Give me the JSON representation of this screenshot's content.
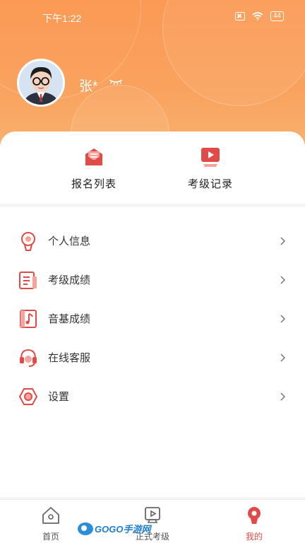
{
  "status_bar": {
    "time": "下午1:22",
    "battery": "44"
  },
  "profile": {
    "name": "张*"
  },
  "quick_actions": [
    {
      "label": "报名列表",
      "icon": "envelope-list-icon"
    },
    {
      "label": "考级记录",
      "icon": "play-record-icon"
    }
  ],
  "menu": [
    {
      "label": "个人信息",
      "icon": "person-badge-icon"
    },
    {
      "label": "考级成绩",
      "icon": "document-icon"
    },
    {
      "label": "音基成绩",
      "icon": "music-note-icon"
    },
    {
      "label": "在线客服",
      "icon": "headset-icon"
    },
    {
      "label": "设置",
      "icon": "hexagon-settings-icon"
    }
  ],
  "tabs": [
    {
      "label": "首页",
      "icon": "home-icon",
      "active": false
    },
    {
      "label": "正式考级",
      "icon": "exam-icon",
      "active": false
    },
    {
      "label": "我的",
      "icon": "profile-icon",
      "active": true
    }
  ],
  "watermark": {
    "text": "GOGO手游网"
  },
  "colors": {
    "accent": "#e14b47",
    "header_start": "#fb9a55",
    "header_end": "#f8b775"
  }
}
